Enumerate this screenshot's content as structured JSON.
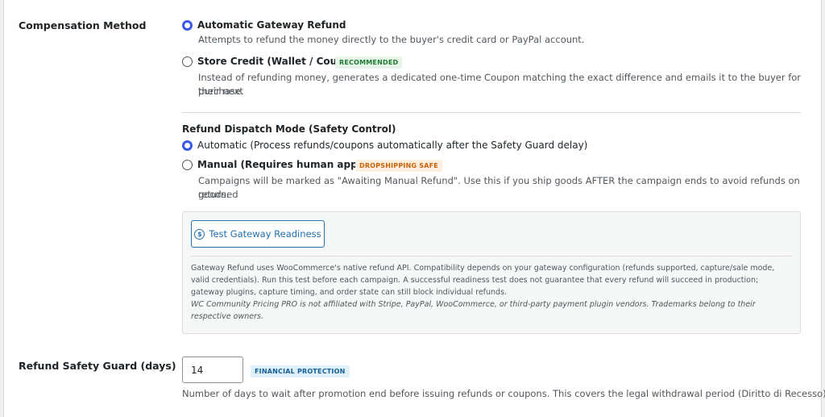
{
  "compensation": {
    "label": "Compensation Method",
    "options": [
      {
        "label": "Automatic Gateway Refund",
        "description": "Attempts to refund the money directly to the buyer's credit card or PayPal account.",
        "checked": true
      },
      {
        "label": "Store Credit (Wallet / Coupon)",
        "badge": "RECOMMENDED",
        "description_line1": "Instead of refunding money, generates a dedicated one-time Coupon matching the exact difference and emails it to the buyer for their next",
        "description_line2": "purchase.",
        "checked": false
      }
    ]
  },
  "dispatch": {
    "title": "Refund Dispatch Mode (Safety Control)",
    "options": [
      {
        "label": "Automatic (Process refunds/coupons automatically after the Safety Guard delay)",
        "checked": true
      },
      {
        "label": "Manual (Requires human approval)",
        "badge": "DROPSHIPPING SAFE",
        "description_line1": "Campaigns will be marked as \"Awaiting Manual Refund\". Use this if you ship goods AFTER the campaign ends to avoid refunds on returned",
        "description_line2": "goods.",
        "checked": false
      }
    ]
  },
  "gateway_box": {
    "button_label": "Test Gateway Readiness",
    "button_icon": "dollar-circle-icon",
    "notice": "Gateway Refund uses WooCommerce's native refund API. Compatibility depends on your gateway configuration (refunds supported, capture/sale mode, valid credentials). Run this test before each campaign. A successful readiness test does not guarantee that every refund will succeed in production; gateway plugins, capture timing, and order state can still block individual refunds.",
    "disclaimer": "WC Community Pricing PRO is not affiliated with Stripe, PayPal, WooCommerce, or third-party payment plugin vendors. Trademarks belong to their respective owners."
  },
  "safety_guard": {
    "label": "Refund Safety Guard (days)",
    "value": "14",
    "badge": "FINANCIAL PROTECTION",
    "help": "Number of days to wait after promotion end before issuing refunds or coupons. This covers the legal withdrawal period (Diritto di Recesso)."
  },
  "colors": {
    "accent": "#3858e9",
    "link": "#2271b1",
    "badge_green_bg": "#e7f5e9",
    "badge_orange_bg": "#fcefdf",
    "badge_blue_bg": "#e0f0fb"
  }
}
